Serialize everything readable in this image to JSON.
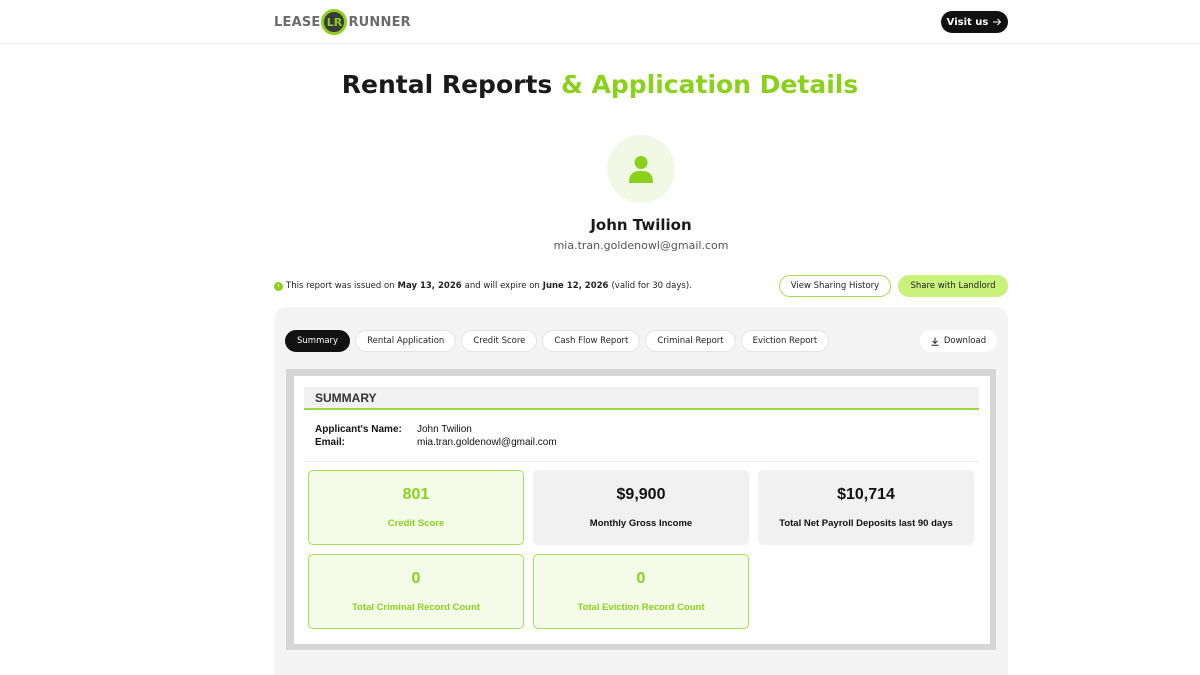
{
  "header": {
    "logo_left": "LEASE",
    "logo_mark": "LR",
    "logo_right": "RUNNER",
    "visit_label": "Visit us",
    "visit_icon": "arrow-right-icon"
  },
  "page": {
    "title_dark": "Rental Reports",
    "title_green": "& Application Details"
  },
  "profile": {
    "avatar_icon": "user-icon",
    "name": "John Twilion",
    "email": "mia.tran.goldenowl@gmail.com"
  },
  "notice": {
    "icon": "clock-icon",
    "prefix": "This report was issued on",
    "issued": "May 13, 2026",
    "middle": "and will expire on",
    "expires": "June 12, 2026",
    "suffix": "(valid for 30 days)."
  },
  "actions": {
    "history_label": "View Sharing History",
    "share_label": "Share with Landlord"
  },
  "tabs": [
    {
      "label": "Summary",
      "active": true
    },
    {
      "label": "Rental Application",
      "active": false
    },
    {
      "label": "Credit Score",
      "active": false
    },
    {
      "label": "Cash Flow Report",
      "active": false
    },
    {
      "label": "Criminal Report",
      "active": false
    },
    {
      "label": "Eviction Report",
      "active": false
    }
  ],
  "download": {
    "label": "Download",
    "icon": "download-icon"
  },
  "summary": {
    "heading": "SUMMARY",
    "applicant_label": "Applicant's Name:",
    "applicant_value": "John Twilion",
    "email_label": "Email:",
    "email_value": "mia.tran.goldenowl@gmail.com",
    "cards": [
      {
        "value": "801",
        "caption": "Credit Score"
      },
      {
        "value": "$9,900",
        "caption": "Monthly Gross Income"
      },
      {
        "value": "$10,714",
        "caption": "Total Net Payroll Deposits last 90 days"
      },
      {
        "value": "0",
        "caption": "Total Criminal Record Count"
      },
      {
        "value": "0",
        "caption": "Total Eviction Record Count"
      }
    ]
  },
  "colors": {
    "accent": "#8ad11c",
    "accent_light": "#c9f27a",
    "dark": "#111111"
  }
}
